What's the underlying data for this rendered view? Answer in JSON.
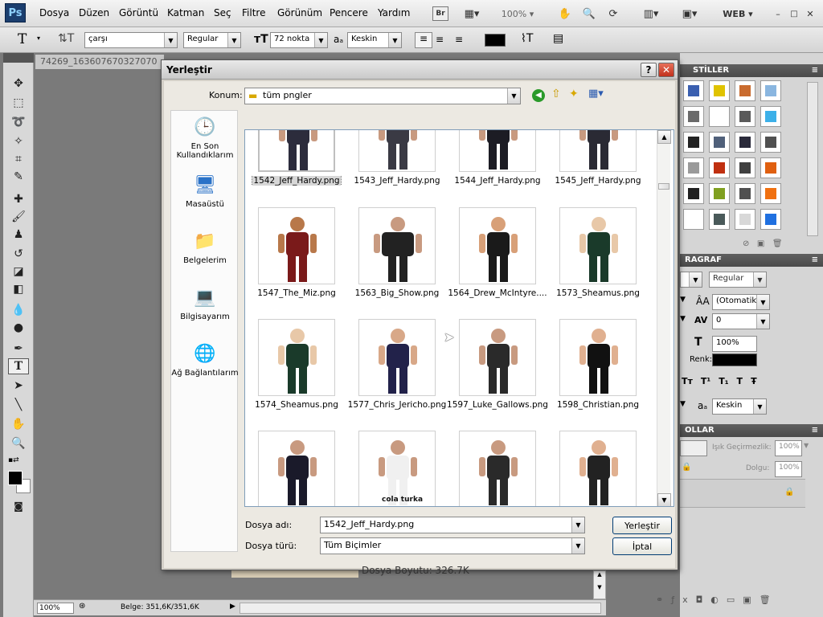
{
  "app": {
    "logo": "Ps"
  },
  "menu": [
    "Dosya",
    "Düzen",
    "Görüntü",
    "Katman",
    "Seç",
    "Filtre",
    "Görünüm",
    "Pencere",
    "Yardım"
  ],
  "menubar_right": {
    "br_label": "Br",
    "zoom": "100%",
    "workspace": "WEB"
  },
  "options": {
    "tool_glyph": "T",
    "font_family": "çarşı",
    "font_style": "Regular",
    "font_size": "72 nokta",
    "aa_label": "aₐ",
    "antialias": "Keskin"
  },
  "document": {
    "tab_title": "74269_163607670327070"
  },
  "dialog": {
    "title": "Yerleştir",
    "help_glyph": "?",
    "close_glyph": "✕",
    "location_label": "Konum:",
    "location_value": "tüm pngler",
    "places": [
      {
        "label": "En Son Kullandıklarım",
        "icon": "recent-icon"
      },
      {
        "label": "Masaüstü",
        "icon": "desktop-icon"
      },
      {
        "label": "Belgelerim",
        "icon": "documents-icon"
      },
      {
        "label": "Bilgisayarım",
        "icon": "computer-icon"
      },
      {
        "label": "Ağ Bağlantılarım",
        "icon": "network-icon"
      }
    ],
    "files": [
      {
        "name": "1542_Jeff_Hardy.png",
        "selected": true
      },
      {
        "name": "1543_Jeff_Hardy.png"
      },
      {
        "name": "1544_Jeff_Hardy.png"
      },
      {
        "name": "1545_Jeff_Hardy.png"
      },
      {
        "name": "1547_The_Miz.png"
      },
      {
        "name": "1563_Big_Show.png"
      },
      {
        "name": "1564_Drew_McIntyre...."
      },
      {
        "name": "1573_Sheamus.png"
      },
      {
        "name": "1574_Sheamus.png"
      },
      {
        "name": "1577_Chris_Jericho.png"
      },
      {
        "name": "1597_Luke_Gallows.png"
      },
      {
        "name": "1598_Christian.png"
      },
      {
        "name": ""
      },
      {
        "name": ""
      },
      {
        "name": ""
      },
      {
        "name": ""
      }
    ],
    "file_name_label": "Dosya adı:",
    "file_name_value": "1542_Jeff_Hardy.png",
    "file_type_label": "Dosya türü:",
    "file_type_value": "Tüm Biçimler",
    "place_button": "Yerleştir",
    "cancel_button": "İptal",
    "file_size": "Dosya Boyutu: 326.7K",
    "shirt_text": "cola turka"
  },
  "panels": {
    "styles_tab": "STİLLER",
    "paragraph_tab": "RAGRAF",
    "font_style": "Regular",
    "leading": "(Otomatik",
    "tracking": "0",
    "scale": "100%",
    "color_label": "Renk:",
    "antialias": "Keskin",
    "layers_tab": "OLLAR",
    "opacity_label": "Işık Geçirmezlik:",
    "opacity_value": "100%",
    "fill_label": "Dolgu:",
    "fill_value": "100%",
    "type_variants": [
      "Tт",
      "T¹",
      "T₁",
      "T",
      "Ŧ"
    ],
    "swatch_colors": [
      "#3a5fb0",
      "#e0c300",
      "#c96b2e",
      "#8ab6e0",
      "#6a6a6a",
      "#ffffff",
      "#5a5a5a",
      "#3cb0e8",
      "#222222",
      "#50607a",
      "#2a2a3a",
      "#505050",
      "#9a9a9a",
      "#c03010",
      "#404040",
      "#e06010",
      "#202020",
      "#80a020",
      "#505050",
      "#f07010",
      "#ffffff",
      "#4a5a5a",
      "#d8d8d8",
      "#2070e0"
    ]
  },
  "status": {
    "zoom": "100%",
    "doc_info": "Belge: 351,6K/351,6K"
  }
}
